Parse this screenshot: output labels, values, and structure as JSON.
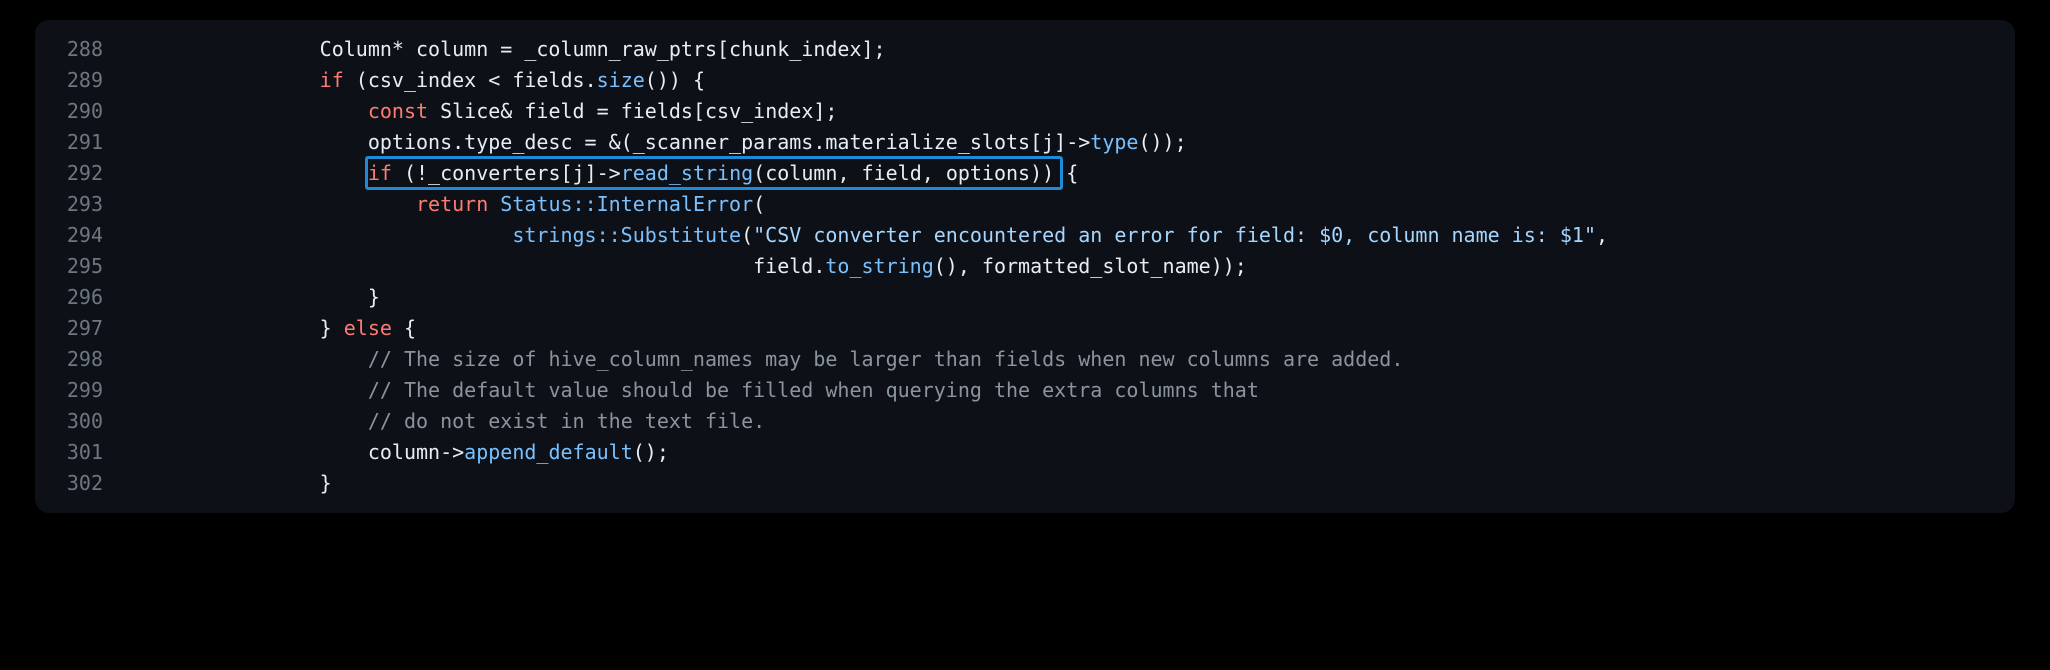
{
  "lines": [
    {
      "num": "288",
      "segments": [
        {
          "cls": "plain",
          "text": "                Column* column = _column_raw_ptrs[chunk_index];"
        }
      ]
    },
    {
      "num": "289",
      "segments": [
        {
          "cls": "plain",
          "text": "                "
        },
        {
          "cls": "kw",
          "text": "if"
        },
        {
          "cls": "plain",
          "text": " (csv_index < fields."
        },
        {
          "cls": "fn",
          "text": "size"
        },
        {
          "cls": "plain",
          "text": "()) {"
        }
      ]
    },
    {
      "num": "290",
      "segments": [
        {
          "cls": "plain",
          "text": "                    "
        },
        {
          "cls": "kw",
          "text": "const"
        },
        {
          "cls": "plain",
          "text": " Slice& field = fields[csv_index];"
        }
      ]
    },
    {
      "num": "291",
      "segments": [
        {
          "cls": "plain",
          "text": "                    options.type_desc = &(_scanner_params.materialize_slots[j]->"
        },
        {
          "cls": "fn",
          "text": "type"
        },
        {
          "cls": "plain",
          "text": "());"
        }
      ]
    },
    {
      "num": "292",
      "highlighted": true,
      "segments": [
        {
          "cls": "plain",
          "text": "                    "
        },
        {
          "cls": "kw",
          "text": "if"
        },
        {
          "cls": "plain",
          "text": " (!_converters[j]->"
        },
        {
          "cls": "fn",
          "text": "read_string"
        },
        {
          "cls": "plain",
          "text": "(column, field, options)) {"
        }
      ]
    },
    {
      "num": "293",
      "segments": [
        {
          "cls": "plain",
          "text": "                        "
        },
        {
          "cls": "kw",
          "text": "return"
        },
        {
          "cls": "plain",
          "text": " "
        },
        {
          "cls": "fn",
          "text": "Status::InternalError"
        },
        {
          "cls": "plain",
          "text": "("
        }
      ]
    },
    {
      "num": "294",
      "segments": [
        {
          "cls": "plain",
          "text": "                                "
        },
        {
          "cls": "fn",
          "text": "strings::Substitute"
        },
        {
          "cls": "plain",
          "text": "("
        },
        {
          "cls": "str",
          "text": "\"CSV converter encountered an error for field: $0, column name is: $1\""
        },
        {
          "cls": "plain",
          "text": ","
        }
      ]
    },
    {
      "num": "295",
      "segments": [
        {
          "cls": "plain",
          "text": "                                                    field."
        },
        {
          "cls": "fn",
          "text": "to_string"
        },
        {
          "cls": "plain",
          "text": "(), formatted_slot_name));"
        }
      ]
    },
    {
      "num": "296",
      "segments": [
        {
          "cls": "plain",
          "text": "                    }"
        }
      ]
    },
    {
      "num": "297",
      "segments": [
        {
          "cls": "plain",
          "text": "                } "
        },
        {
          "cls": "kw",
          "text": "else"
        },
        {
          "cls": "plain",
          "text": " {"
        }
      ]
    },
    {
      "num": "298",
      "segments": [
        {
          "cls": "plain",
          "text": "                    "
        },
        {
          "cls": "cmt",
          "text": "// The size of hive_column_names may be larger than fields when new columns are added."
        }
      ]
    },
    {
      "num": "299",
      "segments": [
        {
          "cls": "plain",
          "text": "                    "
        },
        {
          "cls": "cmt",
          "text": "// The default value should be filled when querying the extra columns that"
        }
      ]
    },
    {
      "num": "300",
      "segments": [
        {
          "cls": "plain",
          "text": "                    "
        },
        {
          "cls": "cmt",
          "text": "// do not exist in the text file."
        }
      ]
    },
    {
      "num": "301",
      "segments": [
        {
          "cls": "plain",
          "text": "                    column->"
        },
        {
          "cls": "fn",
          "text": "append_default"
        },
        {
          "cls": "plain",
          "text": "();"
        }
      ]
    },
    {
      "num": "302",
      "segments": [
        {
          "cls": "plain",
          "text": "                }"
        }
      ]
    }
  ],
  "highlight": {
    "line": "292",
    "left_chars": 20,
    "width_chars": 57
  }
}
